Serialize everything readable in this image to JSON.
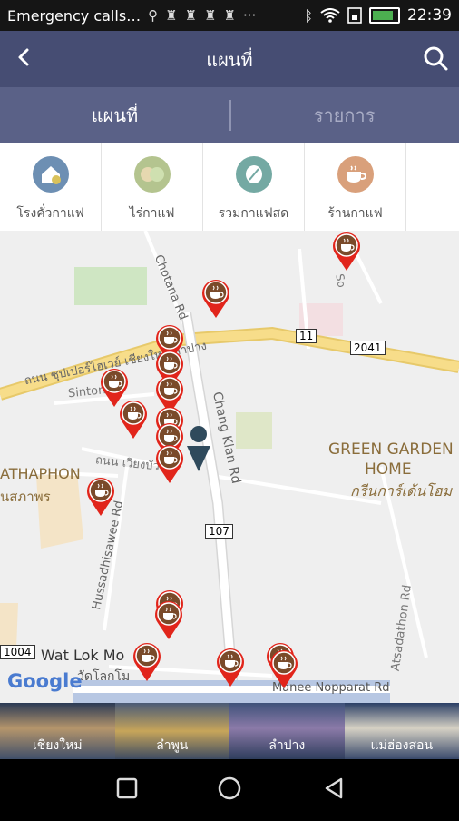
{
  "status_bar": {
    "carrier": "Emergency calls…",
    "time": "22:39",
    "overflow": "···",
    "battery_level": 0.8
  },
  "app_bar": {
    "title": "แผนที่",
    "back_icon": "chevron-left",
    "search_icon": "search"
  },
  "tabs": [
    {
      "label": "แผนที่",
      "active": true
    },
    {
      "label": "รายการ",
      "active": false
    }
  ],
  "categories": [
    {
      "label": "โรงคั่วกาแฟ",
      "icon": "roastery-icon",
      "color": "#6d8fb3"
    },
    {
      "label": "ไร่กาแฟ",
      "icon": "farm-icon",
      "color": "#b4c48f"
    },
    {
      "label": "รวมกาแฟสด",
      "icon": "coffee-bean-icon",
      "color": "#74a9a3"
    },
    {
      "label": "ร้านกาแฟ",
      "icon": "coffee-cup-icon",
      "color": "#d9a07b"
    }
  ],
  "add_button_icon": "plus",
  "map": {
    "road_labels": [
      "Chotana Rd",
      "ถนน ซุปเปอร์ไฮเวย์ เชียงใหม่ ลำปาง",
      "Sintorn",
      "Chang Klan Rd",
      "ถนน เวียงบัว",
      "Hussadhisawee Rd",
      "Atsadathon Rd",
      "Manee Nopparat Rd",
      "So"
    ],
    "place_labels": [
      "GREEN GARDEN HOME",
      "กรีนการ์เด้นโฮม",
      "ATHAPHON",
      "นสภาพร",
      "Wat Lok Mo",
      "วัดโลกโม"
    ],
    "route_shields": [
      "11",
      "2041",
      "107",
      "1004"
    ],
    "logo": "Google",
    "marker_icon": "coffee-cup-icon",
    "marker_color": "#e1251b",
    "location_icon": "person-icon"
  },
  "bottom_nav": [
    {
      "label": "เชียงใหม่"
    },
    {
      "label": "ลำพูน"
    },
    {
      "label": "ลำปาง"
    },
    {
      "label": "แม่ฮ่องสอน"
    }
  ],
  "system_nav": [
    "recent-apps",
    "home",
    "back"
  ],
  "colors": {
    "app_bar": "#464d73",
    "tab_bar": "#5a6187",
    "map_bg": "#efefef",
    "road_yellow": "#f7dd8a"
  }
}
